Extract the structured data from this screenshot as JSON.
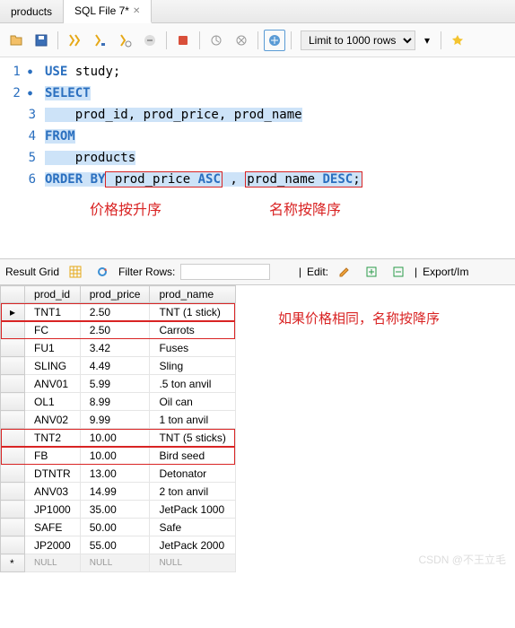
{
  "tabs": {
    "t0": "products",
    "t1": "SQL File 7*"
  },
  "toolbar": {
    "limit": "Limit to 1000 rows"
  },
  "code": {
    "l1a": "USE",
    "l1b": " study;",
    "l2a": "SELECT",
    "l3a": "    prod_id, prod_price, prod_name",
    "l4a": "FROM",
    "l5a": "    products",
    "l6a": "ORDER BY",
    "l6b": " prod_price ",
    "l6c": "ASC",
    "l6d": " , ",
    "l6e": "prod_name ",
    "l6f": "DESC",
    "l6g": ";"
  },
  "anno": {
    "asc": "价格按升序",
    "desc": "名称按降序",
    "same": "如果价格相同，名称按降序"
  },
  "result": {
    "grid_label": "Result Grid",
    "filter_label": "Filter Rows:",
    "edit_label": "Edit:",
    "export_label": "Export/Im"
  },
  "columns": {
    "c0": "prod_id",
    "c1": "prod_price",
    "c2": "prod_name"
  },
  "rows": {
    "r0c0": "TNT1",
    "r0c1": "2.50",
    "r0c2": "TNT (1 stick)",
    "r1c0": "FC",
    "r1c1": "2.50",
    "r1c2": "Carrots",
    "r2c0": "FU1",
    "r2c1": "3.42",
    "r2c2": "Fuses",
    "r3c0": "SLING",
    "r3c1": "4.49",
    "r3c2": "Sling",
    "r4c0": "ANV01",
    "r4c1": "5.99",
    "r4c2": ".5 ton anvil",
    "r5c0": "OL1",
    "r5c1": "8.99",
    "r5c2": "Oil can",
    "r6c0": "ANV02",
    "r6c1": "9.99",
    "r6c2": "1 ton anvil",
    "r7c0": "TNT2",
    "r7c1": "10.00",
    "r7c2": "TNT (5 sticks)",
    "r8c0": "FB",
    "r8c1": "10.00",
    "r8c2": "Bird seed",
    "r9c0": "DTNTR",
    "r9c1": "13.00",
    "r9c2": "Detonator",
    "r10c0": "ANV03",
    "r10c1": "14.99",
    "r10c2": "2 ton anvil",
    "r11c0": "JP1000",
    "r11c1": "35.00",
    "r11c2": "JetPack 1000",
    "r12c0": "SAFE",
    "r12c1": "50.00",
    "r12c2": "Safe",
    "r13c0": "JP2000",
    "r13c1": "55.00",
    "r13c2": "JetPack 2000",
    "null": "NULL"
  },
  "watermark": "CSDN @不王立毛"
}
